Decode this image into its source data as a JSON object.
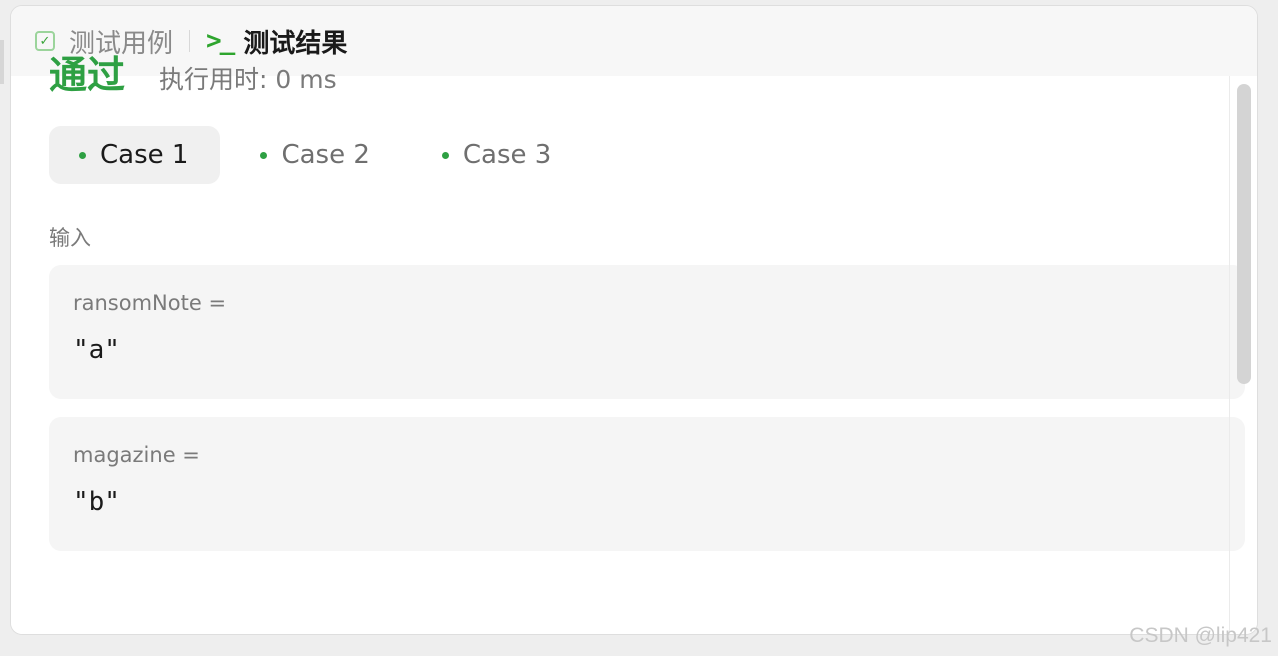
{
  "tabs": [
    {
      "label": "测试用例",
      "icon": "checkbox-icon",
      "active": false
    },
    {
      "label": "测试结果",
      "icon": "terminal-icon",
      "active": true
    }
  ],
  "result": {
    "status": "通过",
    "runtime": "执行用时: 0 ms",
    "status_color": "#2ea043"
  },
  "cases": [
    {
      "label": "Case 1",
      "selected": true
    },
    {
      "label": "Case 2",
      "selected": false
    },
    {
      "label": "Case 3",
      "selected": false
    }
  ],
  "input_section": {
    "label": "输入",
    "params": [
      {
        "name": "ransomNote =",
        "value": "\"a\""
      },
      {
        "name": "magazine =",
        "value": "\"b\""
      }
    ]
  },
  "watermark": "CSDN @lip421"
}
